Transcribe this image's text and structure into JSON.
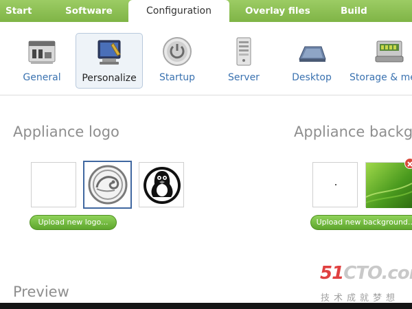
{
  "tabs": [
    {
      "label": "Start"
    },
    {
      "label": "Software"
    },
    {
      "label": "Configuration"
    },
    {
      "label": "Overlay files"
    },
    {
      "label": "Build"
    }
  ],
  "toolbar": {
    "items": [
      {
        "label": "General",
        "icon": "general-icon"
      },
      {
        "label": "Personalize",
        "icon": "personalize-icon",
        "selected": true
      },
      {
        "label": "Startup",
        "icon": "power-icon"
      },
      {
        "label": "Server",
        "icon": "server-icon"
      },
      {
        "label": "Desktop",
        "icon": "desktop-icon"
      },
      {
        "label": "Storage & me",
        "icon": "storage-icon"
      }
    ]
  },
  "logo_section": {
    "title": "Appliance logo",
    "upload_label": "Upload new logo..."
  },
  "background_section": {
    "title": "Appliance backgr",
    "upload_label": "Upload new background..."
  },
  "preview": {
    "title": "Preview"
  },
  "watermark": {
    "line1_red": "51",
    "line1_rest": "CTO.com",
    "line2": "技术成就梦想"
  },
  "colors": {
    "accent_green": "#7fb446",
    "link_blue": "#3a72b0",
    "selected_border": "#3f67a0"
  }
}
